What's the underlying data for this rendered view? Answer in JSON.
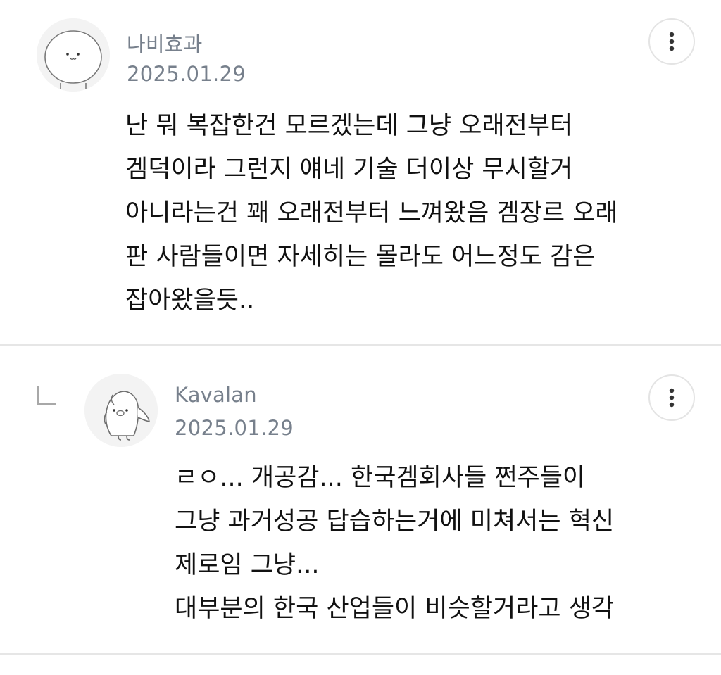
{
  "comments": [
    {
      "author": "나비효과",
      "date": "2025.01.29",
      "body": [
        "난 뭐 복잡한건 모르겠는데 그냥 오래전부터",
        "겜덕이라 그런지 얘네 기술 더이상 무시할거",
        "아니라는건 꽤 오래전부터 느껴왔음 겜장르 오래",
        "판 사람들이면 자세히는 몰라도 어느정도 감은",
        "잡아왔을듯.."
      ],
      "avatar_icon": "bunny-face-avatar-icon",
      "more_icon": "more-vertical-icon"
    },
    {
      "is_reply": true,
      "author": "Kavalan",
      "date": "2025.01.29",
      "body": [
        "ㄹㅇ... 개공감... 한국겜회사들 쩐주들이",
        "그냥 과거성공 답습하는거에 미쳐서는 혁신",
        "제로임 그냥...",
        "대부분의 한국 산업들이 비슷할거라고 생각"
      ],
      "avatar_icon": "penguin-avatar-icon",
      "more_icon": "more-vertical-icon"
    }
  ],
  "colors": {
    "meta_text": "#77808c",
    "body_text": "#111111",
    "divider": "#e6e6e6",
    "avatar_bg": "#f2f2f2"
  }
}
